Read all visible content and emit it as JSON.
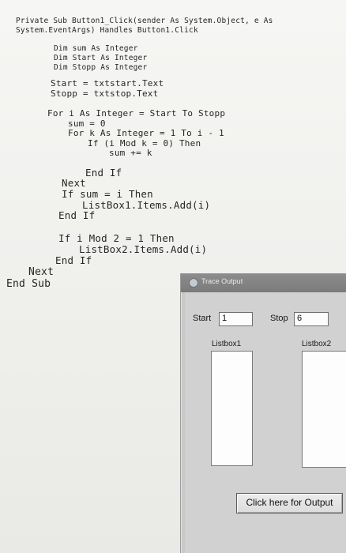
{
  "code": {
    "lines": [
      "Private  Sub  Button1_Click(sender  As  System.Object,  e  As",
      "System.EventArgs) Handles Button1.Click",
      "Dim sum As Integer",
      "Dim Start As Integer",
      "Dim Stopp As Integer",
      "Start = txtstart.Text",
      "Stopp = txtstop.Text",
      "For i As Integer = Start To Stopp",
      "sum = 0",
      "For k As Integer = 1 To i - 1",
      "If (i Mod k = 0) Then",
      "sum += k",
      "End If",
      "Next",
      "If sum = i Then",
      "ListBox1.Items.Add(i)",
      "End If",
      "If i Mod 2 = 1 Then",
      "ListBox2.Items.Add(i)",
      "End If",
      "Next",
      "End Sub"
    ]
  },
  "trace_window": {
    "title": "Trace Output",
    "start_label": "Start",
    "start_value": "1",
    "stop_label": "Stop",
    "stop_value": "6",
    "listbox1_label": "Listbox1",
    "listbox2_label": "Listbox2",
    "output_button_label": "Click here for Output"
  }
}
